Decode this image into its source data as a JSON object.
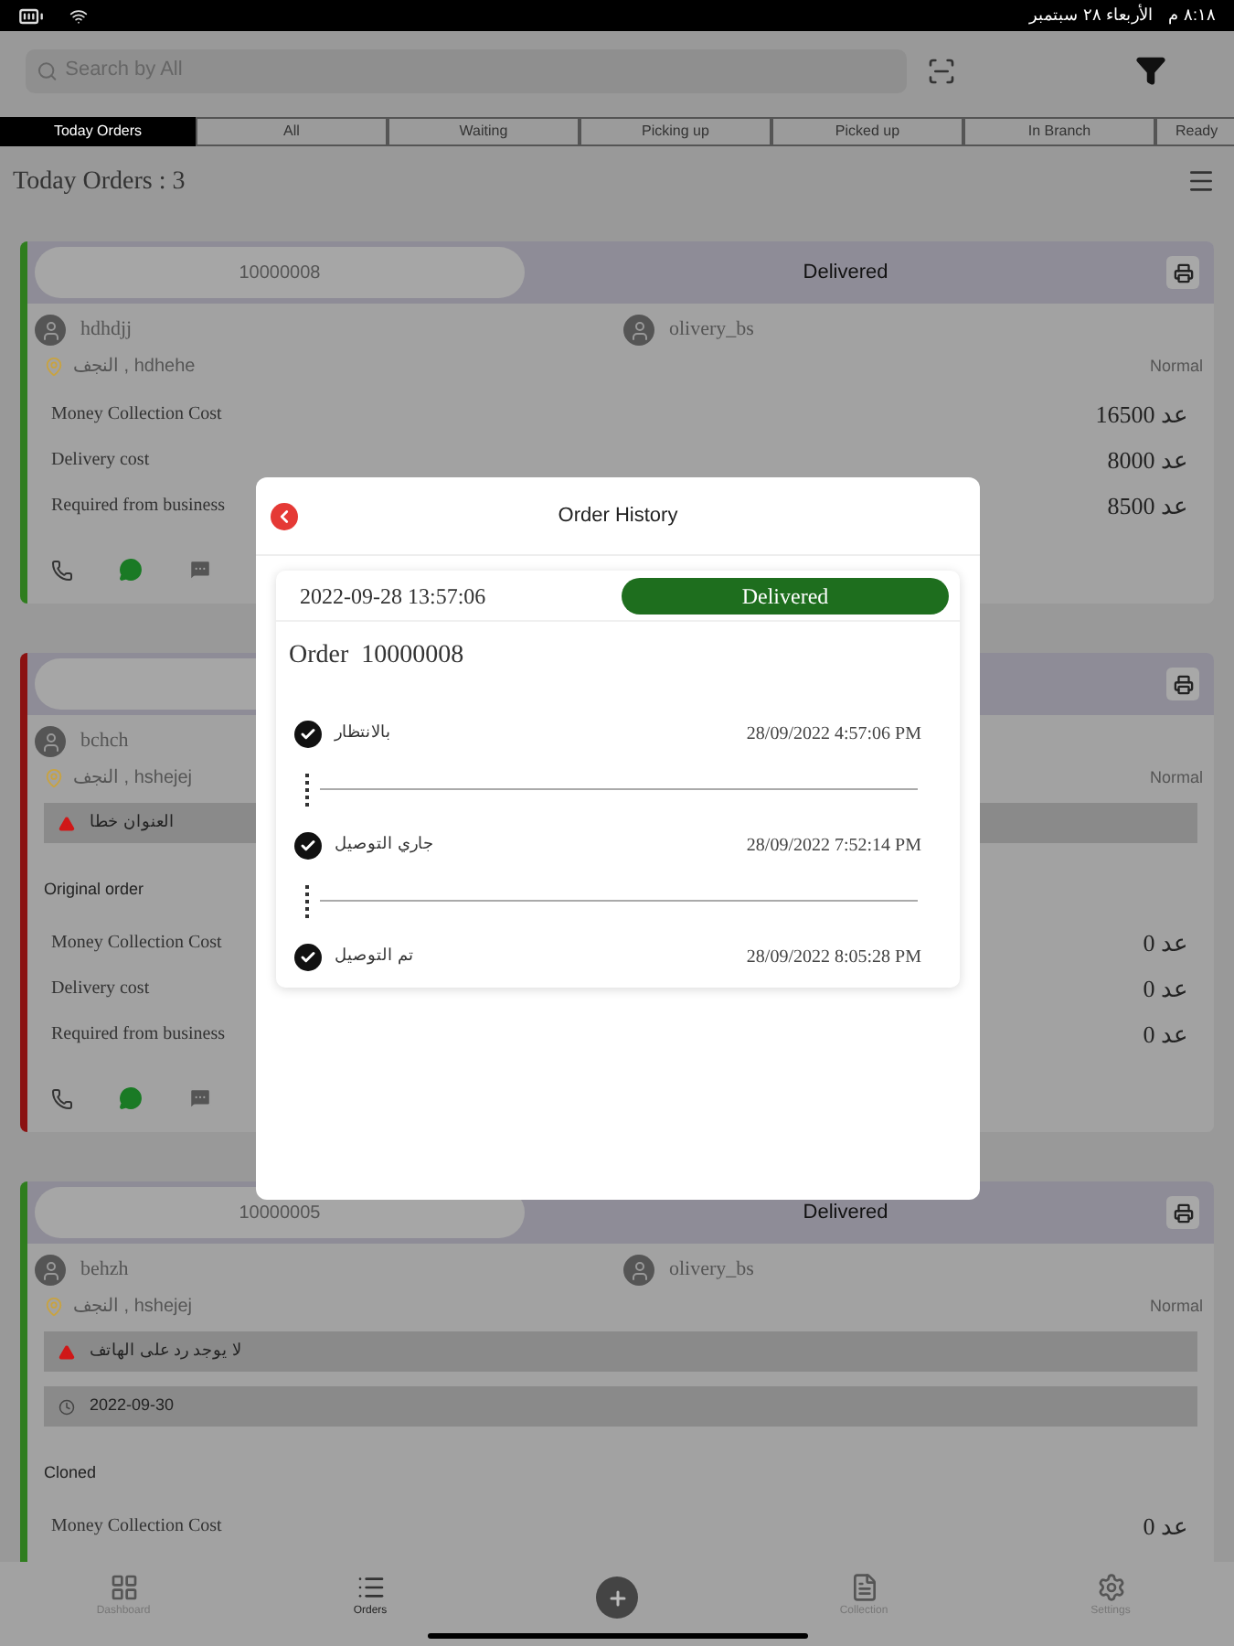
{
  "status_bar": {
    "time": "٨:١٨ م",
    "date": "الأربعاء ٢٨ سبتمبر"
  },
  "search": {
    "placeholder": "Search by All"
  },
  "tabs": [
    {
      "label": "Today Orders",
      "selected": true
    },
    {
      "label": "All",
      "selected": false
    },
    {
      "label": "Waiting",
      "selected": false
    },
    {
      "label": "Picking up",
      "selected": false
    },
    {
      "label": "Picked up",
      "selected": false
    },
    {
      "label": "In Branch",
      "selected": false
    },
    {
      "label": "Ready",
      "selected": false
    }
  ],
  "heading": "Today Orders : 3",
  "orders": [
    {
      "color": "#2f7d1e",
      "id": "10000008",
      "status": "Delivered",
      "customer": "hdhdjj",
      "driver": "olivery_bs",
      "address": "النجف , hdhehe",
      "priority": "Normal",
      "costs": [
        {
          "label": "Money Collection Cost",
          "value": "16500 عد"
        },
        {
          "label": "Delivery cost",
          "value": "8000 عد"
        },
        {
          "label": "Required from business",
          "value": "8500 عد"
        }
      ],
      "contact_buttons": true
    },
    {
      "color": "#8b1212",
      "customer": "bchch",
      "address": "النجف , hshejej",
      "priority": "Normal",
      "notes": [
        {
          "kind": "warning",
          "text": "العنوان خطا"
        },
        {
          "kind": "label",
          "text": "Original order"
        }
      ],
      "costs": [
        {
          "label": "Money Collection Cost",
          "value": "0 عد"
        },
        {
          "label": "Delivery cost",
          "value": "0 عد"
        },
        {
          "label": "Required from business",
          "value": "0 عد"
        }
      ],
      "contact_buttons": true
    },
    {
      "color": "#2f7d1e",
      "id": "10000005",
      "status": "Delivered",
      "customer": "behzh",
      "driver": "olivery_bs",
      "address": "النجف , hshejej",
      "priority": "Normal",
      "notes": [
        {
          "kind": "warning",
          "text": "لا يوجد رد على الهاتف"
        },
        {
          "kind": "date",
          "text": "2022-09-30"
        },
        {
          "kind": "label",
          "text": "Cloned"
        }
      ],
      "costs": [
        {
          "label": "Money Collection Cost",
          "value": "0 عد"
        }
      ]
    }
  ],
  "nav": [
    {
      "label": "Dashboard",
      "kind": "grid",
      "selected": false
    },
    {
      "label": "Orders",
      "kind": "list",
      "selected": true
    },
    {
      "kind": "add",
      "selected": false
    },
    {
      "label": "Collection",
      "kind": "file",
      "selected": false
    },
    {
      "label": "Settings",
      "kind": "gear",
      "selected": false
    }
  ],
  "modal": {
    "title": "Order History",
    "date": "2022-09-28 13:57:06",
    "status": "Delivered",
    "order": "Order  10000008",
    "history": [
      {
        "text": "بالانتظار",
        "time": "28/09/2022 4:57:06 PM"
      },
      {
        "text": "جاري التوصيل",
        "time": "28/09/2022 7:52:14 PM"
      },
      {
        "text": "تم التوصيل",
        "time": "28/09/2022 8:05:28 PM"
      }
    ]
  }
}
